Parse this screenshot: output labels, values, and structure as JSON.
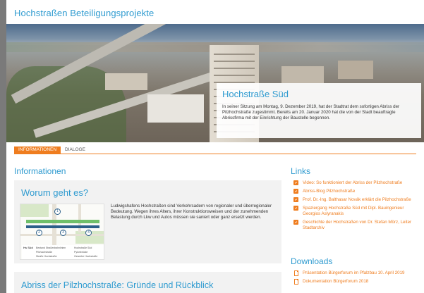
{
  "header": {
    "title": "Hochstraßen Beteiligungsprojekte"
  },
  "hero": {
    "heading": "Hochstraße Süd",
    "text": "In seiner Sitzung am Montag, 9. Dezember 2019, hat der Stadtrat dem sofortigen Abriss der Pilzhochstraße zugestimmt. Bereits am 20. Januar 2020 hat die von der Stadt beauftragte Abrissfirma mit der Einrichtung der Baustelle begonnen."
  },
  "tabs": [
    {
      "label": "Informationen",
      "active": true
    },
    {
      "label": "Dialoge",
      "active": false
    }
  ],
  "main": {
    "section_title": "Informationen",
    "cards": [
      {
        "title": "Worum geht es?",
        "text": "Ludwigshafens Hochstraßen sind Verkehrsadern von regionaler und überregionaler Bedeutung. Wegen ihres Alters, ihrer Konstruktionsweisen und der zunehmenden Belastung durch Lkw und Autos müssen sie saniert oder ganz ersetzt werden.",
        "map_legend": [
          "Bestand Straßenbahnlinien",
          "Pilzhochstraße",
          "Hochstraße Süd",
          "Straße Hochstraße",
          "Pylonbrücke",
          "Gewerbe Hochstraße"
        ],
        "map_marks": [
          "1",
          "2",
          "3",
          "4"
        ],
        "map_caption": "Hs Süd"
      },
      {
        "title": "Abriss der Pilzhochstraße: Gründe und Rückblick"
      }
    ]
  },
  "sidebar": {
    "links_title": "Links",
    "links": [
      "Video: So funktioniert der Abriss der Pilzhochstraße",
      "Abriss-Blog Pilzhochstraße",
      "Prof. Dr.-Ing. Balthasar Novák erklärt die Pilzhochstraße",
      "Spaziergang Hochstraße Süd mit Dipl. Bauingenieur Georgios Aslyranakis",
      "Geschichte der Hochstraßen von Dr. Stefan Mörz, Leiter Stadtarchiv"
    ],
    "downloads_title": "Downloads",
    "downloads": [
      "Präsentation Bürgerforum im Pfalzbau 10. April 2019",
      "Dokumentation Bürgerforum 2018"
    ]
  },
  "colors": {
    "accent": "#ef7d1f",
    "link": "#2f9bd0",
    "card_bg": "#f2f2f2"
  }
}
